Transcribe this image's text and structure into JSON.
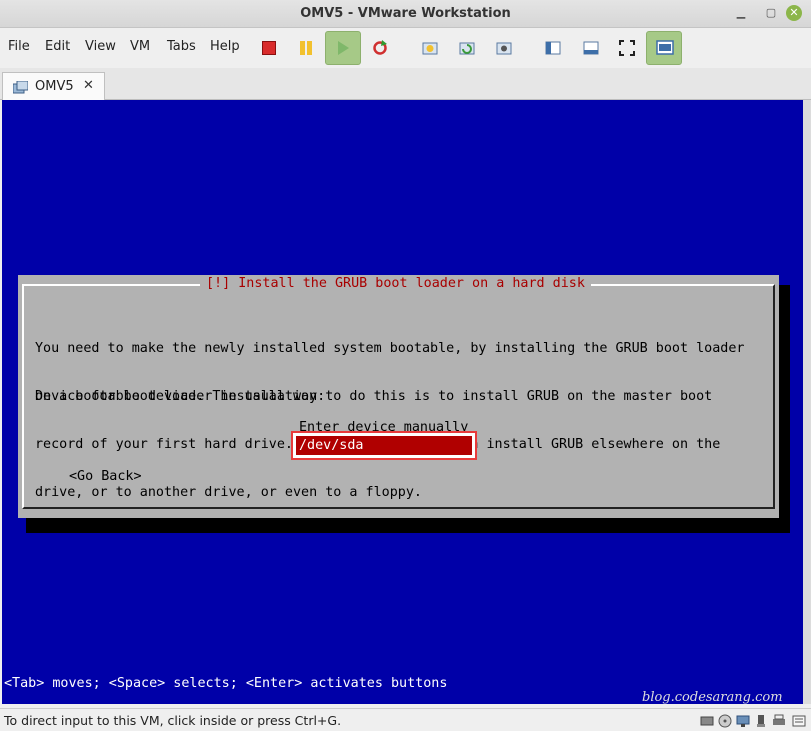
{
  "window": {
    "title": "OMV5 - VMware Workstation"
  },
  "menu": [
    "File",
    "Edit",
    "View",
    "VM",
    "Tabs",
    "Help"
  ],
  "toolbar": {
    "icons": [
      "power-off-icon",
      "suspend-icon",
      "power-on-icon",
      "reset-icon",
      "snapshot-icon",
      "revert-snapshot-icon",
      "snapshot-manager-icon",
      "library-view-icon",
      "console-view-icon",
      "fullscreen-icon",
      "unity-icon"
    ]
  },
  "tab": {
    "label": "OMV5",
    "close": "✕"
  },
  "installer": {
    "dialog_title": "[!] Install the GRUB boot loader on a hard disk",
    "body_lines": [
      "You need to make the newly installed system bootable, by installing the GRUB boot loader",
      "on a bootable device. The usual way to do this is to install GRUB on the master boot",
      "record of your first hard drive. If you prefer, you can install GRUB elsewhere on the",
      "drive, or to another drive, or even to a floppy."
    ],
    "prompt": "Device for boot loader installation:",
    "hint": "Enter device manually",
    "input_value": "/dev/sda",
    "back_button": "<Go Back>",
    "footer": "<Tab> moves; <Space> selects; <Enter> activates buttons"
  },
  "watermark": "blog.codesarang.com",
  "status": {
    "text": "To direct input to this VM, click inside or press Ctrl+G."
  },
  "colors": {
    "console_bg": "#0000a8",
    "dialog_bg": "#b2b2b2",
    "title_red": "#a80000",
    "input_red": "#b00000",
    "active_green": "#a6c987"
  }
}
